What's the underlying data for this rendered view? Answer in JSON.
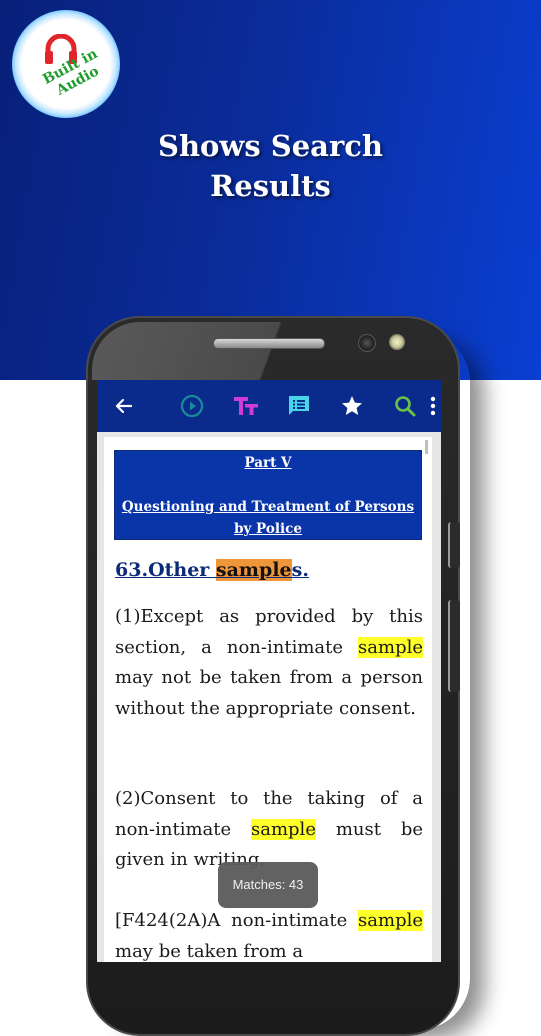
{
  "promo": {
    "badge_text": "Built in Audio",
    "badge_line1": "Built in",
    "badge_line2": "Audio",
    "title_line1": "Shows Search",
    "title_line2": "Results"
  },
  "toolbar": {
    "icons": [
      "back-arrow-icon",
      "play-icon",
      "text-size-icon",
      "notes-icon",
      "bookmark-star-icon",
      "search-icon",
      "more-options-icon"
    ],
    "colors": {
      "background": "#0a2a8c",
      "play": "#1a8a9a",
      "text_size": "#d13bd6",
      "notes": "#4ad4e8",
      "star": "#ffffff",
      "search": "#6cc04a"
    }
  },
  "content": {
    "part_label": "Part V",
    "part_title": "Questioning and Treatment of Persons by Police",
    "section_number": "63.",
    "section_title_before": "Other ",
    "section_title_highlight": "sample",
    "section_title_after": "s.",
    "paragraph1": {
      "before": "(1)Except as provided by this section, a non-intimate ",
      "highlight": "sample",
      "after": " may not be taken from a person without the appropriate consent."
    },
    "paragraph2": {
      "before": "(2)Consent to the taking of a non-intimate ",
      "highlight": "sample",
      "after": " must be given in writing."
    },
    "paragraph3": {
      "before": "[F424(2A)A non-intimate ",
      "highlight": "sample",
      "after": " may be taken from a"
    },
    "search_term": "sample",
    "highlight_colors": {
      "current": "#f0963a",
      "other": "#ffff2a"
    }
  },
  "toast": {
    "text": "Matches: 43"
  }
}
